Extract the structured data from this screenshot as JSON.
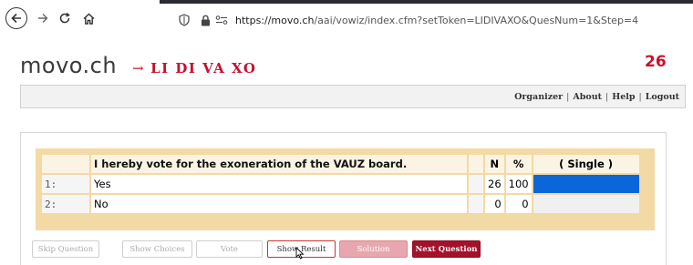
{
  "browser": {
    "url_host": "https://movo.ch",
    "url_path": "/aai/vowiz/index.cfm?setToken=LIDIVAXO&QuesNum=1&Step=4"
  },
  "header": {
    "logo": "movo.ch",
    "token_arrow": "→",
    "token": "LI DI VA XO",
    "count": "26"
  },
  "menu": {
    "items": [
      "Organizer",
      "About",
      "Help",
      "Logout"
    ],
    "separator": "|"
  },
  "question": {
    "text": "I hereby vote for the exoneration of the VAUZ board.",
    "col_n": "N",
    "col_pct": "%",
    "col_mode": "( Single )",
    "answers": [
      {
        "index": "1:",
        "label": "Yes",
        "n": "26",
        "pct": "100",
        "share": 1.0
      },
      {
        "index": "2:",
        "label": "No",
        "n": "0",
        "pct": "0",
        "share": 0.0
      }
    ],
    "bar_color": "#0a66d9"
  },
  "buttons": {
    "skip": "Skip Question",
    "show_choices": "Show Choices",
    "vote": "Vote",
    "show_result": "Show Result",
    "solution": "Solution",
    "next": "Next Question"
  },
  "colors": {
    "accent": "#c8102e",
    "next_button": "#a3122a",
    "frame": "#f3d9a4"
  }
}
